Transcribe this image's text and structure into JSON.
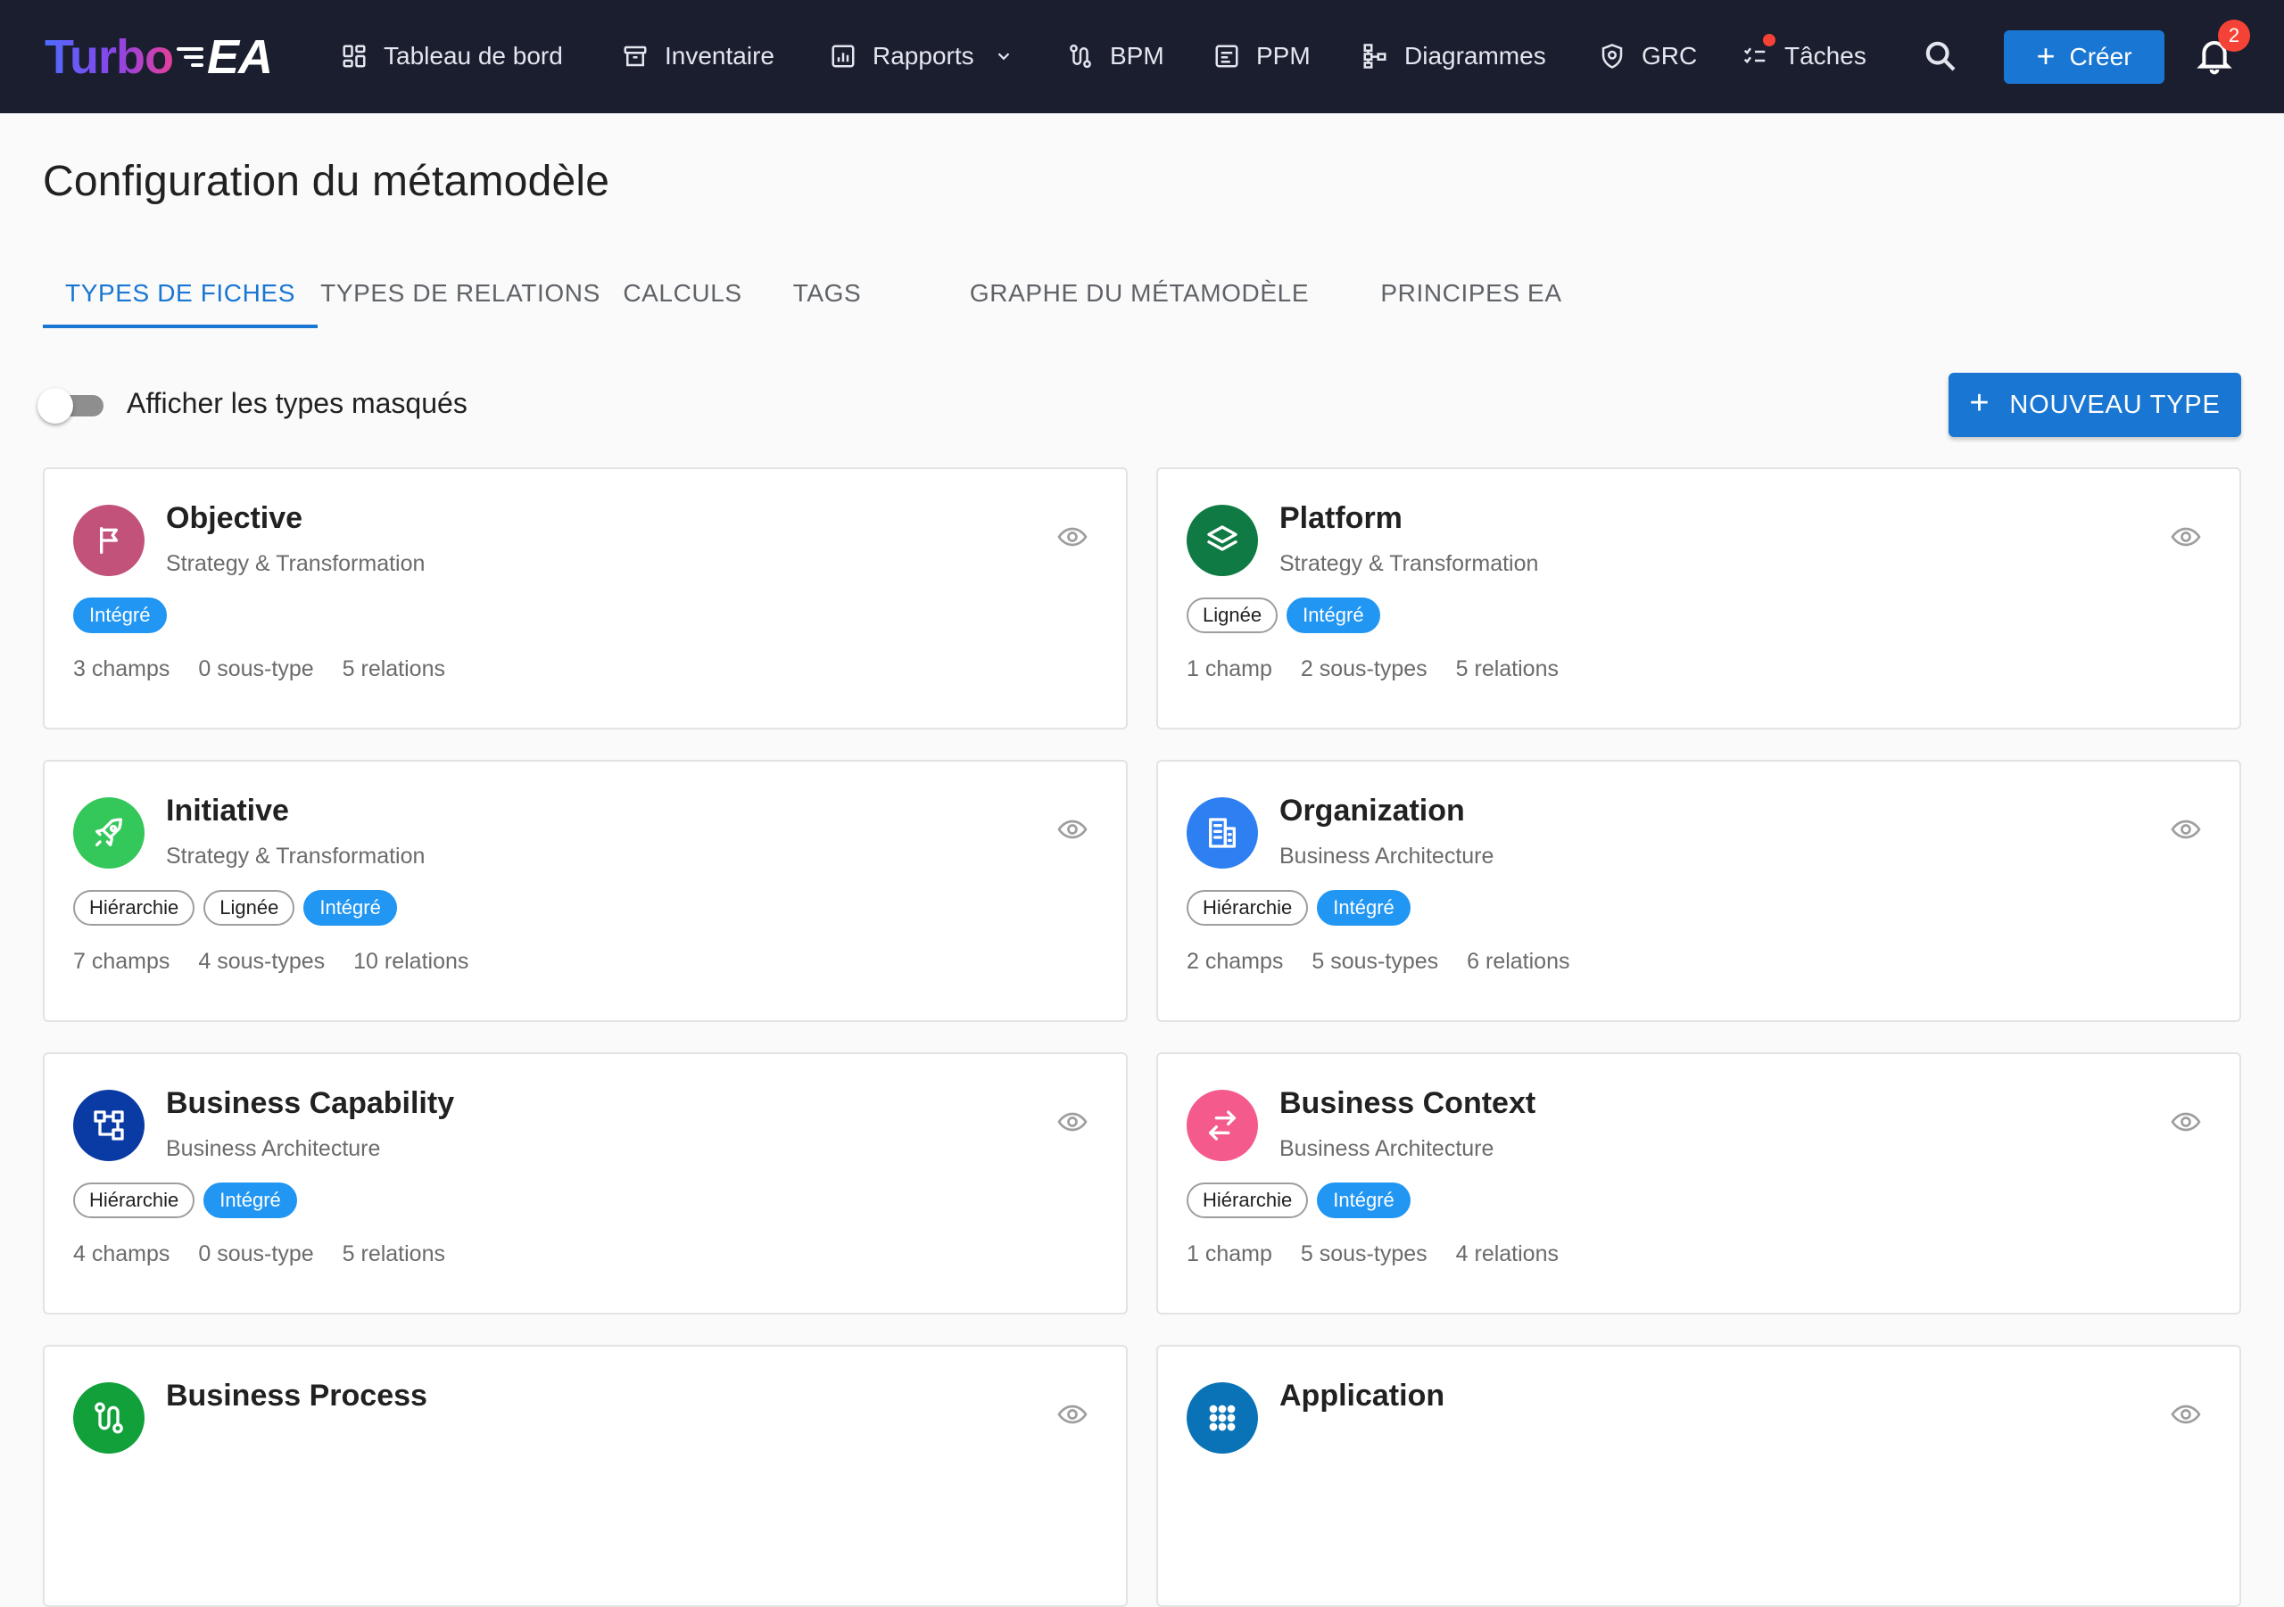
{
  "app": {
    "logo_text_1": "Turbo",
    "logo_text_2": "EA"
  },
  "nav": {
    "items": [
      {
        "label": "Tableau de bord",
        "icon": "dashboard-icon"
      },
      {
        "label": "Inventaire",
        "icon": "inventory-icon"
      },
      {
        "label": "Rapports",
        "icon": "reports-icon",
        "has_dropdown": true
      },
      {
        "label": "BPM",
        "icon": "bpm-icon"
      },
      {
        "label": "PPM",
        "icon": "ppm-icon"
      },
      {
        "label": "Diagrammes",
        "icon": "diagrams-icon"
      },
      {
        "label": "GRC",
        "icon": "grc-icon"
      },
      {
        "label": "Tâches",
        "icon": "tasks-icon",
        "has_dot": true
      }
    ],
    "create_label": "Créer",
    "notification_count": "2"
  },
  "page": {
    "title": "Configuration du métamodèle",
    "tabs": [
      {
        "label": "TYPES DE FICHES",
        "active": true
      },
      {
        "label": "TYPES DE RELATIONS",
        "active": false
      },
      {
        "label": "CALCULS",
        "active": false
      },
      {
        "label": "TAGS",
        "active": false
      },
      {
        "label": "GRAPHE DU MÉTAMODÈLE",
        "active": false
      },
      {
        "label": "PRINCIPES EA",
        "active": false
      }
    ],
    "toggle_label": "Afficher les types masqués",
    "toggle_on": false,
    "new_type_label": "NOUVEAU TYPE"
  },
  "cards": [
    {
      "name": "Objective",
      "category": "Strategy & Transformation",
      "color": "#c2527a",
      "icon": "flag-icon",
      "tags": [
        {
          "label": "Intégré",
          "style": "filled"
        }
      ],
      "stats": [
        "3 champs",
        "0 sous-type",
        "5 relations"
      ]
    },
    {
      "name": "Platform",
      "category": "Strategy & Transformation",
      "color": "#0f7a43",
      "icon": "layers-icon",
      "tags": [
        {
          "label": "Lignée",
          "style": "outline"
        },
        {
          "label": "Intégré",
          "style": "filled"
        }
      ],
      "stats": [
        "1 champ",
        "2 sous-types",
        "5 relations"
      ]
    },
    {
      "name": "Initiative",
      "category": "Strategy & Transformation",
      "color": "#34c759",
      "icon": "rocket-icon",
      "tags": [
        {
          "label": "Hiérarchie",
          "style": "outline"
        },
        {
          "label": "Lignée",
          "style": "outline"
        },
        {
          "label": "Intégré",
          "style": "filled"
        }
      ],
      "stats": [
        "7 champs",
        "4 sous-types",
        "10 relations"
      ]
    },
    {
      "name": "Organization",
      "category": "Business Architecture",
      "color": "#2d7ff2",
      "icon": "building-icon",
      "tags": [
        {
          "label": "Hiérarchie",
          "style": "outline"
        },
        {
          "label": "Intégré",
          "style": "filled"
        }
      ],
      "stats": [
        "2 champs",
        "5 sous-types",
        "6 relations"
      ]
    },
    {
      "name": "Business Capability",
      "category": "Business Architecture",
      "color": "#0a3aa3",
      "icon": "hierarchy-icon",
      "tags": [
        {
          "label": "Hiérarchie",
          "style": "outline"
        },
        {
          "label": "Intégré",
          "style": "filled"
        }
      ],
      "stats": [
        "4 champs",
        "0 sous-type",
        "5 relations"
      ]
    },
    {
      "name": "Business Context",
      "category": "Business Architecture",
      "color": "#f45b8c",
      "icon": "swap-icon",
      "tags": [
        {
          "label": "Hiérarchie",
          "style": "outline"
        },
        {
          "label": "Intégré",
          "style": "filled"
        }
      ],
      "stats": [
        "1 champ",
        "5 sous-types",
        "4 relations"
      ]
    },
    {
      "name": "Business Process",
      "category": "",
      "color": "#11a03a",
      "icon": "process-icon",
      "tags": [],
      "stats": []
    },
    {
      "name": "Application",
      "category": "",
      "color": "#0a73b8",
      "icon": "apps-icon",
      "tags": [],
      "stats": []
    }
  ]
}
